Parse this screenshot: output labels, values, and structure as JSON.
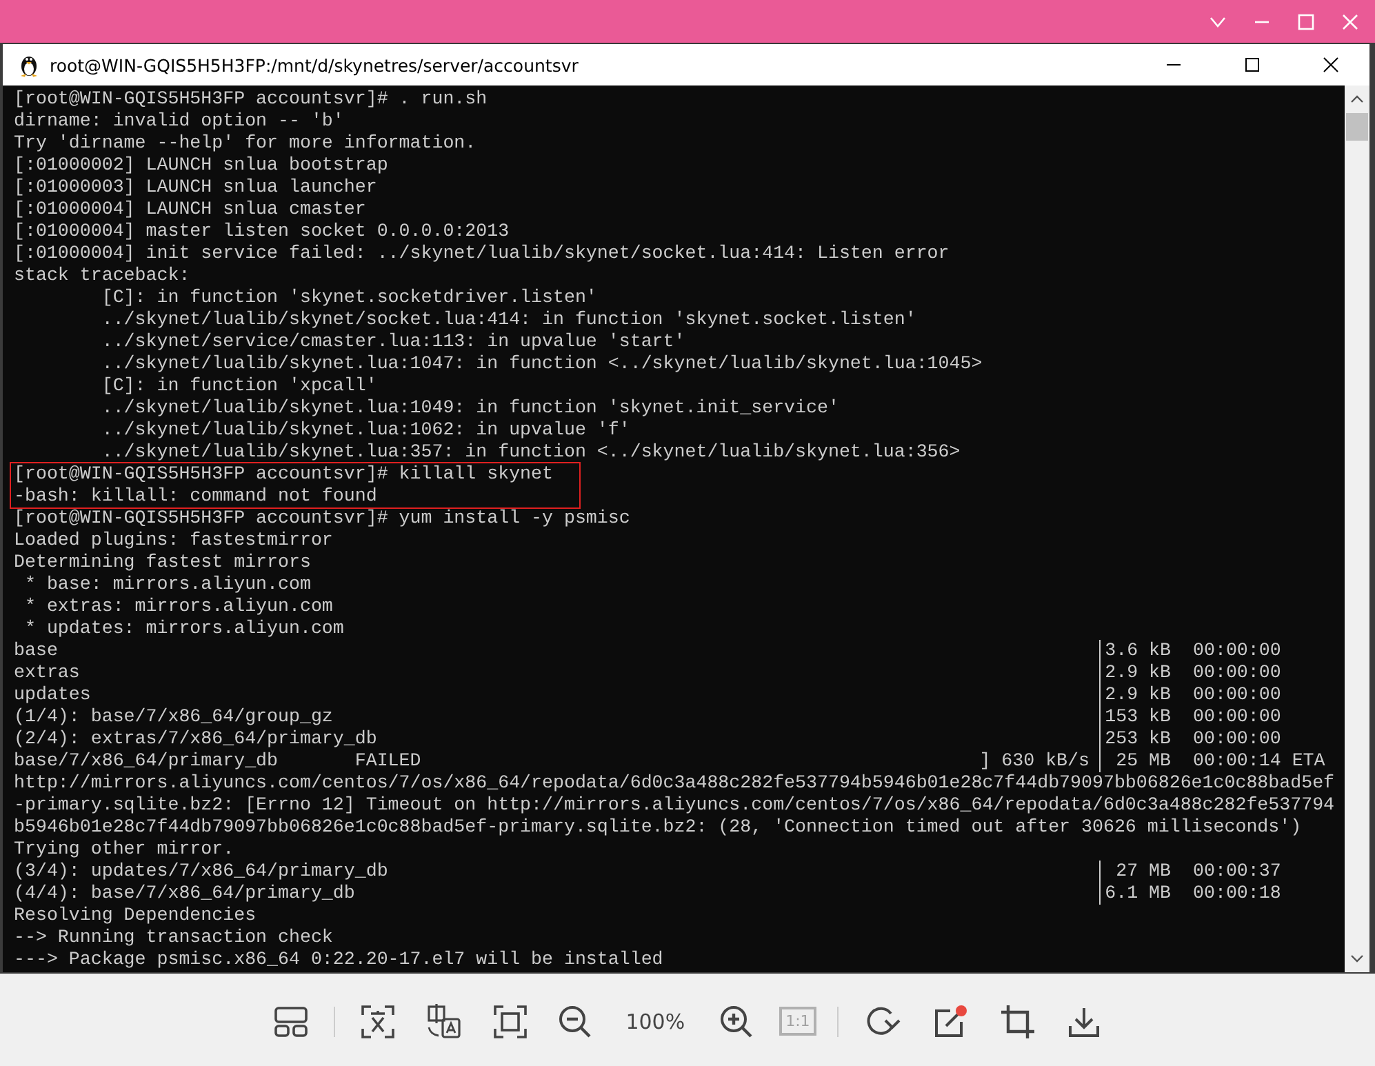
{
  "terminal_window": {
    "title": "root@WIN-GQIS5H5H3FP:/mnt/d/skynetres/server/accountsvr",
    "lines": [
      {
        "kind": "plain",
        "text": "[root@WIN-GQIS5H5H3FP accountsvr]# . run.sh"
      },
      {
        "kind": "plain",
        "text": "dirname: invalid option -- 'b'"
      },
      {
        "kind": "plain",
        "text": "Try 'dirname --help' for more information."
      },
      {
        "kind": "plain",
        "text": "[:01000002] LAUNCH snlua bootstrap"
      },
      {
        "kind": "plain",
        "text": "[:01000003] LAUNCH snlua launcher"
      },
      {
        "kind": "plain",
        "text": "[:01000004] LAUNCH snlua cmaster"
      },
      {
        "kind": "plain",
        "text": "[:01000004] master listen socket 0.0.0.0:2013"
      },
      {
        "kind": "plain",
        "text": "[:01000004] init service failed: ../skynet/lualib/skynet/socket.lua:414: Listen error"
      },
      {
        "kind": "plain",
        "text": "stack traceback:"
      },
      {
        "kind": "plain",
        "text": "        [C]: in function 'skynet.socketdriver.listen'"
      },
      {
        "kind": "plain",
        "text": "        ../skynet/lualib/skynet/socket.lua:414: in function 'skynet.socket.listen'"
      },
      {
        "kind": "plain",
        "text": "        ../skynet/service/cmaster.lua:113: in upvalue 'start'"
      },
      {
        "kind": "plain",
        "text": "        ../skynet/lualib/skynet.lua:1047: in function <../skynet/lualib/skynet.lua:1045>"
      },
      {
        "kind": "plain",
        "text": "        [C]: in function 'xpcall'"
      },
      {
        "kind": "plain",
        "text": "        ../skynet/lualib/skynet.lua:1049: in function 'skynet.init_service'"
      },
      {
        "kind": "plain",
        "text": "        ../skynet/lualib/skynet.lua:1062: in upvalue 'f'"
      },
      {
        "kind": "plain",
        "text": "        ../skynet/lualib/skynet.lua:357: in function <../skynet/lualib/skynet.lua:356>"
      },
      {
        "kind": "highlight",
        "lines": [
          "[root@WIN-GQIS5H5H3FP accountsvr]# killall skynet",
          "-bash: killall: command not found"
        ]
      },
      {
        "kind": "plain",
        "text": "[root@WIN-GQIS5H5H3FP accountsvr]# yum install -y psmisc"
      },
      {
        "kind": "plain",
        "text": "Loaded plugins: fastestmirror"
      },
      {
        "kind": "plain",
        "text": "Determining fastest mirrors"
      },
      {
        "kind": "plain",
        "text": " * base: mirrors.aliyun.com"
      },
      {
        "kind": "plain",
        "text": " * extras: mirrors.aliyun.com"
      },
      {
        "kind": "plain",
        "text": " * updates: mirrors.aliyun.com"
      },
      {
        "kind": "transfer",
        "text": "base",
        "size": "3.6 kB",
        "time": "00:00:00"
      },
      {
        "kind": "transfer",
        "text": "extras",
        "size": "2.9 kB",
        "time": "00:00:00"
      },
      {
        "kind": "transfer",
        "text": "updates",
        "size": "2.9 kB",
        "time": "00:00:00"
      },
      {
        "kind": "transfer",
        "text": "(1/4): base/7/x86_64/group_gz",
        "size": "153 kB",
        "time": "00:00:00"
      },
      {
        "kind": "transfer",
        "text": "(2/4): extras/7/x86_64/primary_db",
        "size": "253 kB",
        "time": "00:00:00"
      },
      {
        "kind": "transfer",
        "text": "base/7/x86_64/primary_db       FAILED",
        "rate": "] 630 kB/s",
        "size": "25 MB",
        "time": "00:00:14 ETA"
      },
      {
        "kind": "plain",
        "text": "http://mirrors.aliyuncs.com/centos/7/os/x86_64/repodata/6d0c3a488c282fe537794b5946b01e28c7f44db79097bb06826e1c0c88bad5ef"
      },
      {
        "kind": "plain",
        "text": "-primary.sqlite.bz2: [Errno 12] Timeout on http://mirrors.aliyuncs.com/centos/7/os/x86_64/repodata/6d0c3a488c282fe537794"
      },
      {
        "kind": "plain",
        "text": "b5946b01e28c7f44db79097bb06826e1c0c88bad5ef-primary.sqlite.bz2: (28, 'Connection timed out after 30626 milliseconds')"
      },
      {
        "kind": "plain",
        "text": "Trying other mirror."
      },
      {
        "kind": "transfer",
        "text": "(3/4): updates/7/x86_64/primary_db",
        "size": "27 MB",
        "time": "00:00:37"
      },
      {
        "kind": "transfer",
        "text": "(4/4): base/7/x86_64/primary_db",
        "size": "6.1 MB",
        "time": "00:00:18"
      },
      {
        "kind": "plain",
        "text": "Resolving Dependencies"
      },
      {
        "kind": "plain",
        "text": "--> Running transaction check"
      },
      {
        "kind": "plain",
        "text": "---> Package psmisc.x86_64 0:22.20-17.el7 will be installed"
      }
    ]
  },
  "toolbar": {
    "zoom_level": "100%",
    "actual_size": {
      "label": "1:1",
      "disabled": true
    }
  }
}
